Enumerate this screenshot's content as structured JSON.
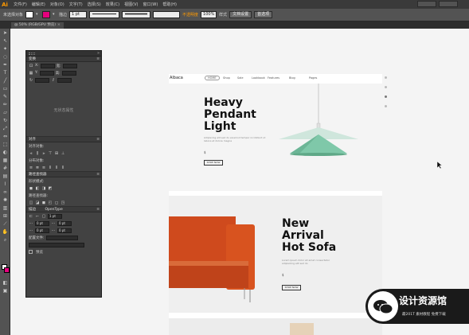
{
  "app": {
    "logo": "Ai",
    "menus": [
      "文件(F)",
      "编辑(E)",
      "对象(O)",
      "文字(T)",
      "选择(S)",
      "效果(C)",
      "视图(V)",
      "窗口(W)",
      "帮助(H)"
    ]
  },
  "control_bar": {
    "selection_label": "未选择对象",
    "stroke_label": "描边",
    "stroke_width": "1 pt",
    "style_label": "不透明度",
    "opacity": "100%",
    "style_btn": "样式",
    "doc_setup_btn": "文档设置",
    "prefs_btn": "首选项"
  },
  "document_tab": {
    "title": "@ 50% (RGB/GPU 预览)",
    "close": "×"
  },
  "panel": {
    "header_close": "»",
    "transform_title": "变换",
    "fields": {
      "x_label": "X:",
      "y_label": "Y:",
      "w_label": "宽:",
      "h_label": "高:"
    },
    "empty_text": "无状态属性",
    "align_title": "对齐",
    "align_objects_label": "对齐对象:",
    "distribute_label": "分布对象:",
    "distribute_spacing_label": "分布间距:",
    "pathfinder_title": "路径查找器",
    "shape_modes_label": "形状模式:",
    "pathfinders_label": "路径查找器:",
    "stroke_title": "描边",
    "opentype_label": "OpenType",
    "weight_value": "1 pt",
    "field_a": "0 pt",
    "field_b": "0 pt",
    "field_c": "0 pt",
    "field_d": "0 pt",
    "profile_label": "配置文件:",
    "preview_label": "预览"
  },
  "artboard": {
    "logo": "Albaca",
    "nav_items": [
      "HOME",
      "Shop",
      "Sale",
      "Lookbook",
      "Features",
      "Blog",
      "Pages"
    ],
    "hero1": {
      "title_lines": [
        "Heavy",
        "Pendant",
        "Light"
      ],
      "body": "Adipiscing elit sed do eiusmod tempor incididunt ut labore et dolore magna",
      "price": "$",
      "button": "SHOP NOW"
    },
    "hero2": {
      "title_lines": [
        "New",
        "Arrival",
        "Hot Sofa"
      ],
      "body": "Lorem ipsum dolor sit amet consectetur adipisicing elit sed do",
      "price": "$",
      "button": "SHOP NOW"
    }
  },
  "watermark": {
    "title": "设计资源馆",
    "subtitle": "最201T 素材教程 免费下载"
  },
  "colors": {
    "ui_dark": "#535353",
    "panel_bg": "#424242",
    "lamp_green": "#7fc8a9",
    "lamp_light": "#c5e3d6",
    "sofa_orange": "#d64b1f",
    "accent_magenta": "#e6007e",
    "logo_orange": "#ff9a00"
  }
}
